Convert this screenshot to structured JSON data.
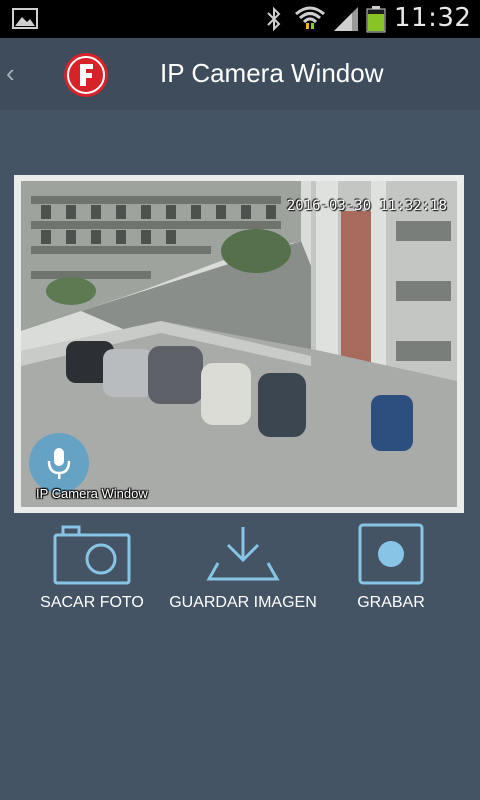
{
  "status_bar": {
    "time": "11:32",
    "icons": [
      "gallery-icon",
      "bluetooth-icon",
      "wifi-icon",
      "signal-icon",
      "battery-icon"
    ]
  },
  "app_bar": {
    "back_icon": "chevron-left-icon",
    "logo_letter": "F",
    "title": "IP Camera Window"
  },
  "camera": {
    "timestamp": "2016-03-30 11:32:18",
    "overlay_label": "IP Camera Window",
    "mic_icon": "microphone-icon"
  },
  "actions": {
    "photo_label": "SACAR FOTO",
    "save_label": "GUARDAR IMAGEN",
    "record_label": "GRABAR"
  },
  "colors": {
    "background": "#455464",
    "app_bar": "#3e4c5b",
    "accent": "#87c4e6",
    "logo_red": "#d8222a"
  }
}
